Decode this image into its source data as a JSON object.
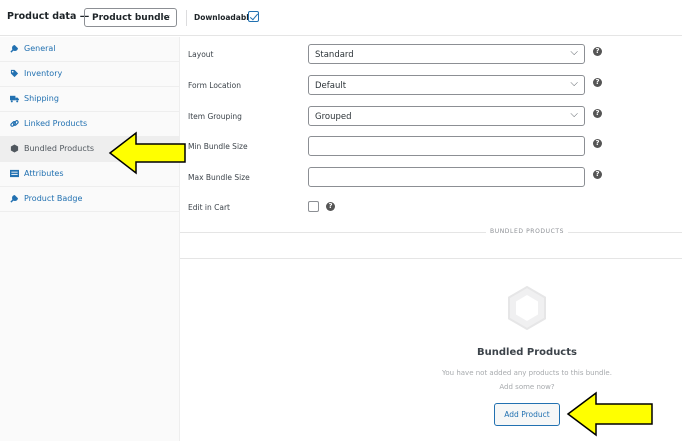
{
  "header": {
    "product_data_label": "Product data —",
    "product_type_value": "Product bundle",
    "downloadable_label": "Downloadable:",
    "downloadable_checked": true
  },
  "sidebar": {
    "items": [
      {
        "label": "General",
        "icon": "wrench-icon",
        "active": false
      },
      {
        "label": "Inventory",
        "icon": "tag-icon",
        "active": false
      },
      {
        "label": "Shipping",
        "icon": "truck-icon",
        "active": false
      },
      {
        "label": "Linked Products",
        "icon": "link-icon",
        "active": false
      },
      {
        "label": "Bundled Products",
        "icon": "cube-icon",
        "active": true
      },
      {
        "label": "Attributes",
        "icon": "list-icon",
        "active": false
      },
      {
        "label": "Product Badge",
        "icon": "wrench-icon",
        "active": false
      }
    ]
  },
  "form": {
    "layout": {
      "label": "Layout",
      "value": "Standard"
    },
    "form_location": {
      "label": "Form Location",
      "value": "Default"
    },
    "item_grouping": {
      "label": "Item Grouping",
      "value": "Grouped"
    },
    "min_bundle_size": {
      "label": "Min Bundle Size",
      "value": ""
    },
    "max_bundle_size": {
      "label": "Max Bundle Size",
      "value": ""
    },
    "edit_in_cart": {
      "label": "Edit in Cart",
      "checked": false
    },
    "help_glyph": "?"
  },
  "bundled_section": {
    "divider_label": "BUNDLED PRODUCTS",
    "empty_title": "Bundled Products",
    "empty_line1": "You have not added any products to this bundle.",
    "empty_line2": "Add some now?",
    "add_button_label": "Add Product"
  },
  "colors": {
    "link": "#2271b1",
    "arrow_fill": "#ffff00",
    "arrow_stroke": "#000000"
  }
}
